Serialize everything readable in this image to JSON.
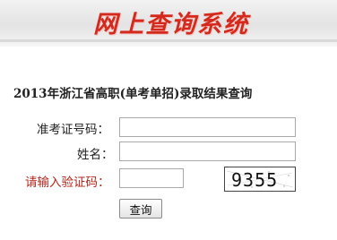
{
  "banner": {
    "title": "网上查询系统"
  },
  "page": {
    "heading": "2013年浙江省高职(单考单招)录取结果查询"
  },
  "form": {
    "exam_number_label": "准考证号码：",
    "exam_number_value": "",
    "name_label": "姓名：",
    "name_value": "",
    "captcha_label": "请输入验证码：",
    "captcha_value": "",
    "captcha_code": "9355",
    "submit_label": "查询"
  }
}
